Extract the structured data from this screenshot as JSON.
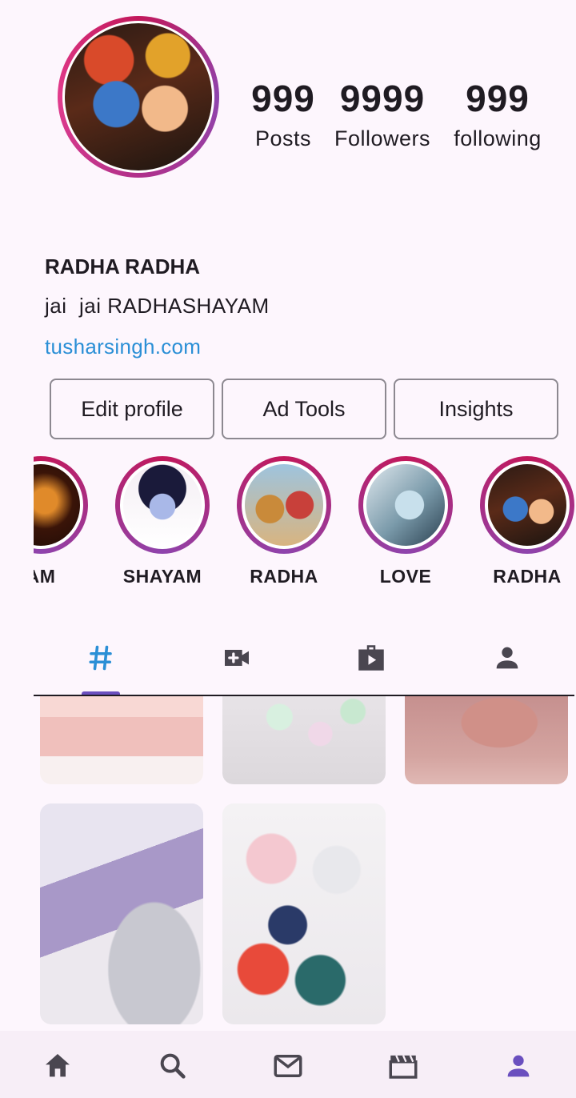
{
  "profile": {
    "stats": [
      {
        "value": "999",
        "label": "Posts"
      },
      {
        "value": "9999",
        "label": "Followers"
      },
      {
        "value": "999",
        "label": "following"
      }
    ],
    "name": "RADHA RADHA",
    "bio": "jai  jai RADHASHAYAM",
    "website": "tusharsingh.com"
  },
  "actions": {
    "edit_profile": "Edit profile",
    "ad_tools": "Ad Tools",
    "insights": "Insights"
  },
  "highlights": [
    "AM",
    "SHAYAM",
    "RADHA",
    "LOVE",
    "RADHA"
  ],
  "tabs": {
    "grid_icon": "hashtag-icon",
    "reels_icon": "video-camera-add-icon",
    "clips_icon": "play-portfolio-icon",
    "tagged_icon": "person-icon"
  },
  "bottom_nav": [
    "home-icon",
    "search-icon",
    "mail-icon",
    "clapperboard-icon",
    "profile-icon"
  ],
  "colors": {
    "background": "#fdf6fd",
    "accent": "#6a4fbf",
    "link": "#2b8fd6",
    "ring": "#c2185b",
    "active_tab": "#2b8fd6"
  }
}
